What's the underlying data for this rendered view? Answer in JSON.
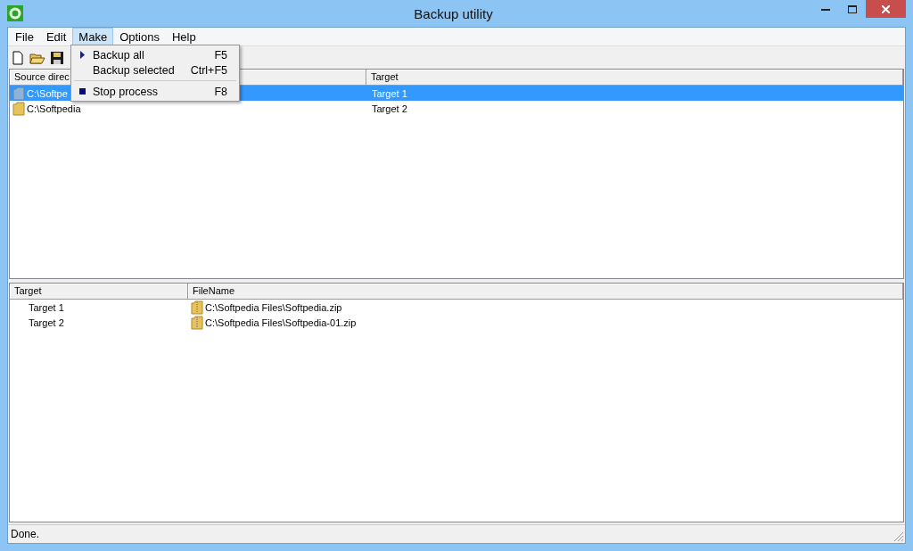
{
  "window": {
    "title": "Backup utility"
  },
  "menu_bar": [
    {
      "label": "File",
      "selected": false
    },
    {
      "label": "Edit",
      "selected": false
    },
    {
      "label": "Make",
      "selected": true
    },
    {
      "label": "Options",
      "selected": false
    },
    {
      "label": "Help",
      "selected": false
    }
  ],
  "dropdown": [
    {
      "kind": "play",
      "label": "Backup all",
      "shortcut": "F5"
    },
    {
      "kind": "plain",
      "label": "Backup selected",
      "shortcut": "Ctrl+F5"
    },
    {
      "kind": "separator"
    },
    {
      "kind": "stop",
      "label": "Stop process",
      "shortcut": "F8"
    }
  ],
  "sources_table": {
    "columns": [
      "Source direc",
      "Target"
    ],
    "rows": [
      {
        "source": "C:\\Softpe",
        "target": "Target 1",
        "selected": true
      },
      {
        "source": "C:\\Softpedia",
        "target": "Target 2",
        "selected": false
      }
    ]
  },
  "files_table": {
    "columns": [
      "Target",
      "FileName"
    ],
    "rows": [
      {
        "target": "Target 1",
        "file": "C:\\Softpedia Files\\Softpedia.zip"
      },
      {
        "target": "Target 2",
        "file": "C:\\Softpedia Files\\Softpedia-01.zip"
      }
    ]
  },
  "status_bar": "Done."
}
